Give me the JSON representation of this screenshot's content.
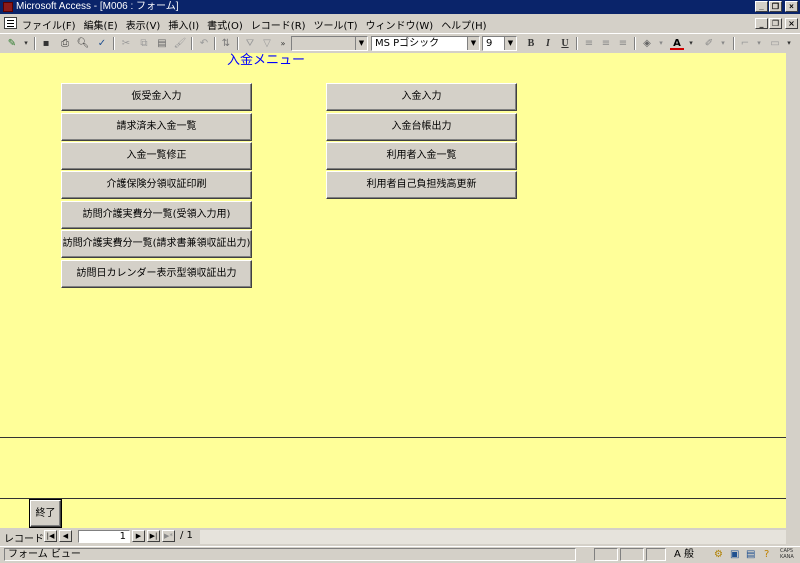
{
  "window": {
    "title": "Microsoft Access - [M006 : フォーム]",
    "minimize": "_",
    "restore": "❐",
    "close": "×"
  },
  "menubar": {
    "items": [
      "ファイル(F)",
      "編集(E)",
      "表示(V)",
      "挿入(I)",
      "書式(O)",
      "レコード(R)",
      "ツール(T)",
      "ウィンドウ(W)",
      "ヘルプ(H)"
    ]
  },
  "toolbar": {
    "object_combo": "",
    "font_name": "MS Pゴシック",
    "font_size": "9",
    "bold": "B",
    "italic": "I",
    "underline": "U"
  },
  "form": {
    "heading": "入金メニュー",
    "left_buttons": [
      "仮受金入力",
      "請求済未入金一覧",
      "入金一覧修正",
      "介護保険分領収証印刷",
      "訪問介護実費分一覧(受領入力用)",
      "訪問介護実費分一覧(請求書兼領収証出力)",
      "訪問日カレンダー表示型領収証出力"
    ],
    "right_buttons": [
      "入金入力",
      "入金台帳出力",
      "利用者入金一覧",
      "利用者自己負担残高更新"
    ],
    "end_button": "終了"
  },
  "record_nav": {
    "label": "レコード:",
    "current": "1",
    "total": "/ 1"
  },
  "status": {
    "text": "フォーム ビュー",
    "ime_mode": "A 般",
    "caps": "CAPS",
    "kana": "KANA"
  }
}
